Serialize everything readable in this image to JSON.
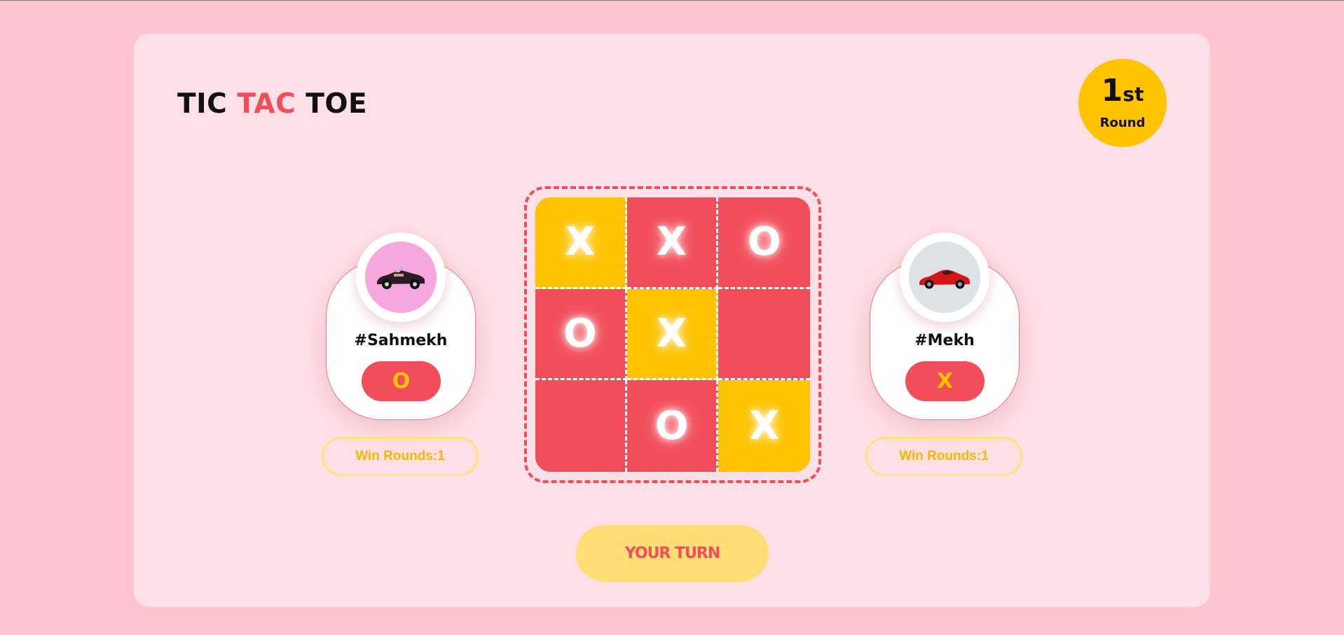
{
  "header": {
    "title_part1": "TIC",
    "title_part2": "TAC",
    "title_part3": "TOE"
  },
  "round": {
    "number": "1",
    "suffix": "st",
    "label": "Round"
  },
  "players": [
    {
      "name": "#Sahmekh",
      "symbol": "O",
      "win_rounds": "Win Rounds:1",
      "avatar": "black-convertible-car-photo"
    },
    {
      "name": "#Mekh",
      "symbol": "X",
      "win_rounds": "Win Rounds:1",
      "avatar": "red-sports-car-photo"
    }
  ],
  "board": {
    "cells": [
      "X",
      "X",
      "O",
      "O",
      "X",
      "",
      "",
      "O",
      "X"
    ],
    "highlighted_cells": [
      0,
      4,
      8
    ]
  },
  "turn_button": "YOUR TURN",
  "colors": {
    "background": "#ffc4ce",
    "card": "#ffe0e6",
    "accent_red": "#f24d5a",
    "accent_yellow": "#ffc300",
    "button_yellow": "#ffde75"
  }
}
